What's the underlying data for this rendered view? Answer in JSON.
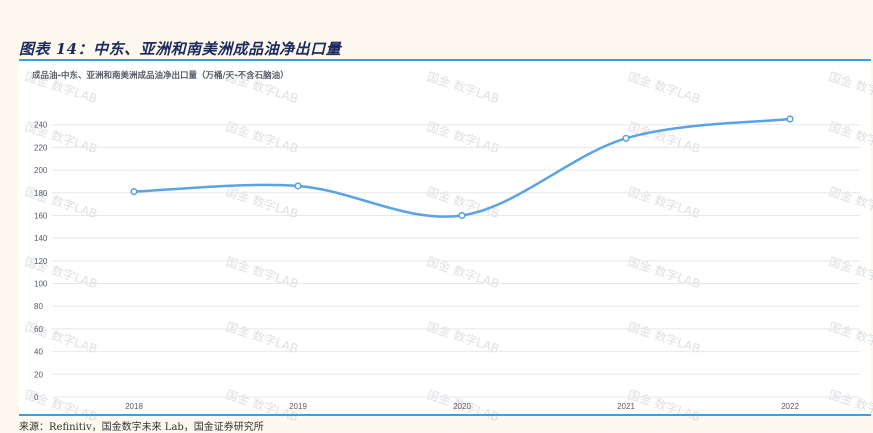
{
  "figure": {
    "title": "图表 14：中东、亚洲和南美洲成品油净出口量",
    "source": "来源：Refinitiv，国金数字未来 Lab，国金证券研究所"
  },
  "watermark": "国金 数字LAB",
  "colors": {
    "line": "#5aa3e6",
    "rule": "#3aa0e0",
    "grid": "#e6e8ec",
    "title": "#1c2a5e"
  },
  "chart_data": {
    "type": "line",
    "title": "成品油-中东、亚洲和南美洲成品油净出口量（万桶/天-不含石脑油）",
    "xlabel": "",
    "ylabel": "",
    "categories": [
      "2018",
      "2019",
      "2020",
      "2021",
      "2022"
    ],
    "series": [
      {
        "values": [
          181,
          186,
          160,
          228,
          245
        ]
      }
    ],
    "ylim": [
      0,
      260
    ],
    "yticks": [
      0,
      20,
      40,
      60,
      80,
      100,
      120,
      140,
      160,
      180,
      200,
      220,
      240
    ],
    "grid": true,
    "smooth": true
  }
}
